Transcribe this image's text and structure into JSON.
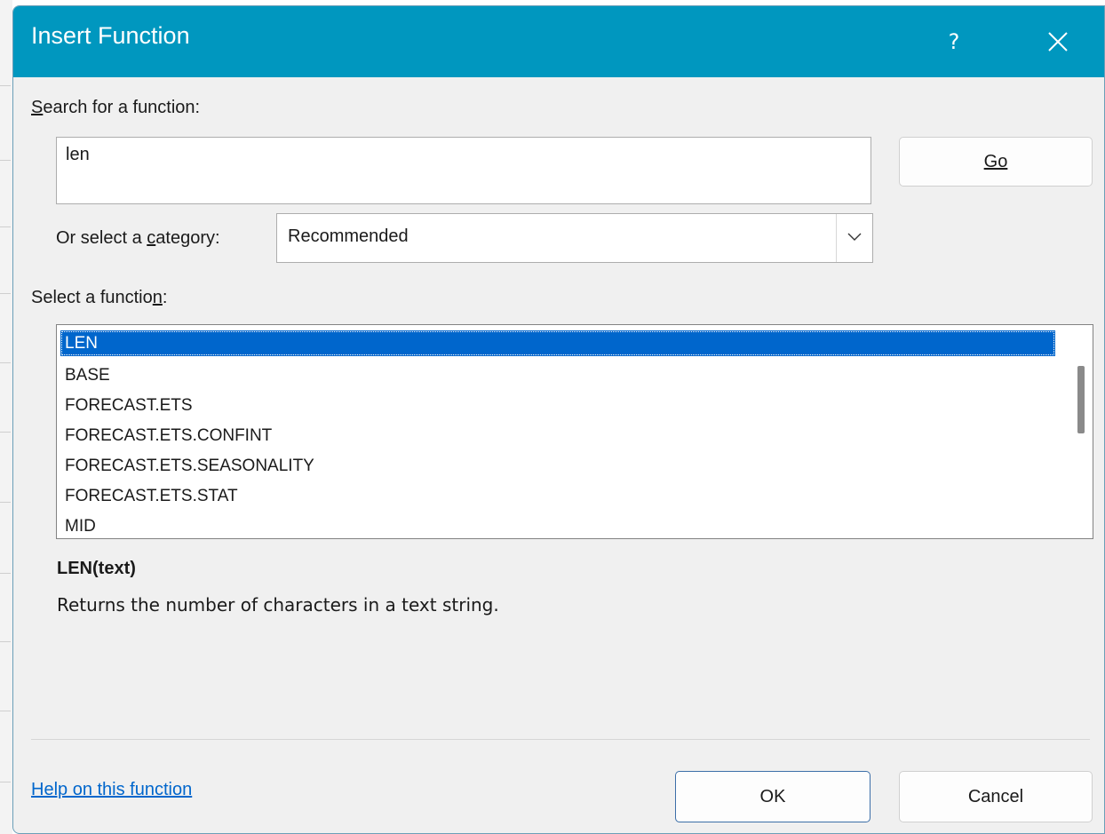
{
  "dialog": {
    "title": "Insert Function",
    "help_glyph": "?"
  },
  "search": {
    "label": "Search for a function:",
    "value": "len",
    "go_label": "Go"
  },
  "category": {
    "label": "Or select a category:",
    "selected": "Recommended"
  },
  "functions": {
    "label": "Select a function:",
    "items": [
      "LEN",
      "BASE",
      "FORECAST.ETS",
      "FORECAST.ETS.CONFINT",
      "FORECAST.ETS.SEASONALITY",
      "FORECAST.ETS.STAT",
      "MID"
    ],
    "selected_index": 0,
    "signature": "LEN(text)",
    "description": "Returns the number of characters in a text string."
  },
  "footer": {
    "help_link": "Help on this function",
    "ok_label": "OK",
    "cancel_label": "Cancel"
  },
  "colors": {
    "titlebar": "#0097bf",
    "selection": "#0066cc",
    "link": "#0066cc"
  }
}
